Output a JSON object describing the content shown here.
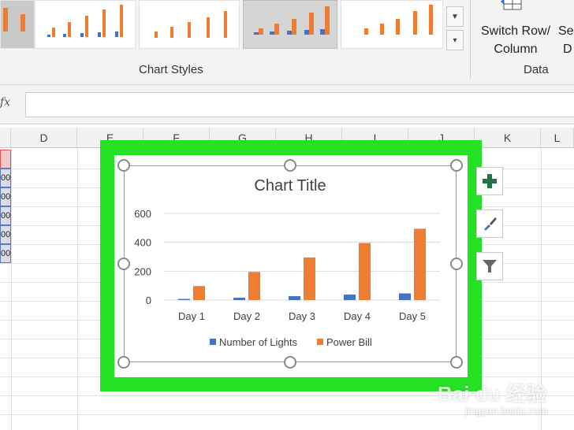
{
  "ribbon": {
    "chart_styles_label": "Chart Styles",
    "data_label": "Data",
    "switch_row_col": [
      "Switch Row/",
      "Column"
    ],
    "select_data_partial": [
      "Se",
      "D"
    ],
    "scroll_down": "▼",
    "more": "▾"
  },
  "formula_bar": {
    "fx": "fx"
  },
  "columns": [
    "D",
    "E",
    "F",
    "G",
    "H",
    "I",
    "J",
    "K",
    "L"
  ],
  "selected_cells": [
    "00",
    "00",
    "00",
    "00",
    "00"
  ],
  "chart_data": {
    "type": "bar",
    "title": "Chart Title",
    "categories": [
      "Day 1",
      "Day 2",
      "Day 3",
      "Day 4",
      "Day 5"
    ],
    "series": [
      {
        "name": "Number of Lights",
        "values": [
          8,
          16,
          27,
          38,
          46
        ],
        "color": "#4472c4"
      },
      {
        "name": "Power Bill",
        "values": [
          97,
          195,
          295,
          395,
          494
        ],
        "color": "#ed7d31"
      }
    ],
    "ylim": [
      0,
      600
    ],
    "yticks": [
      0,
      200,
      400,
      600
    ],
    "grid": true,
    "legend": "bottom"
  },
  "watermark": {
    "brand": "Bai du 经验",
    "url": "jingyan.baidu.com"
  }
}
